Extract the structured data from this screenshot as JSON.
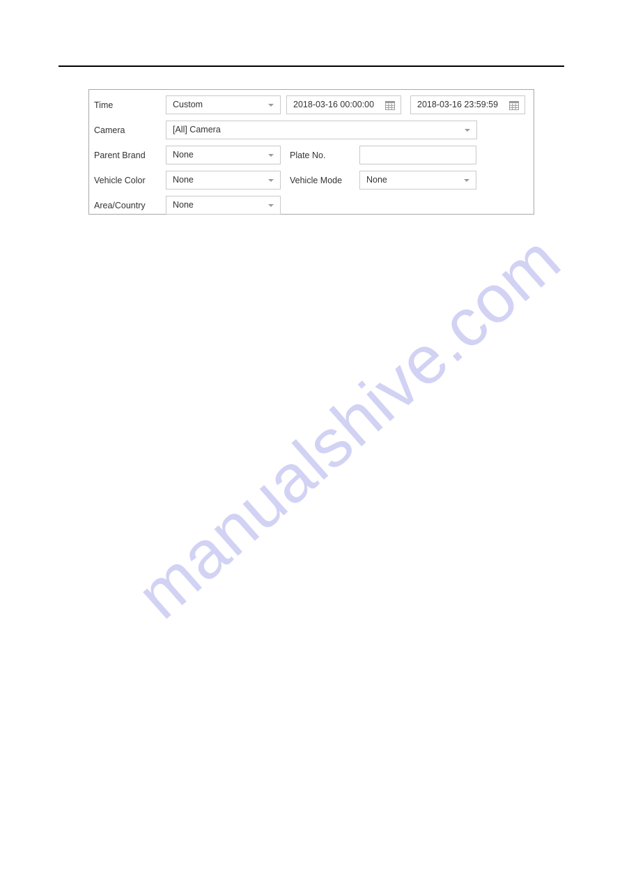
{
  "page": {
    "watermark_text": "manualshive.com",
    "watermark_color": "#d2d2f4",
    "rule_color": "#000000",
    "panel_border_color": "#a8a8a8",
    "control_border_color": "#c9c9c9",
    "text_color": "#333333"
  },
  "form": {
    "rows": {
      "time": {
        "label": "Time",
        "mode_value": "Custom",
        "start_value": "2018-03-16 00:00:00",
        "end_value": "2018-03-16 23:59:59",
        "start_icon": "calendar-icon",
        "end_icon": "calendar-icon"
      },
      "camera": {
        "label": "Camera",
        "value": "[All] Camera"
      },
      "parent_brand": {
        "label": "Parent Brand",
        "value": "None"
      },
      "plate_no": {
        "label": "Plate No.",
        "value": "",
        "placeholder": ""
      },
      "vehicle_color": {
        "label": "Vehicle Color",
        "value": "None"
      },
      "vehicle_mode": {
        "label": "Vehicle Mode",
        "value": "None"
      },
      "area_country": {
        "label": "Area/Country",
        "value": "None"
      }
    }
  }
}
